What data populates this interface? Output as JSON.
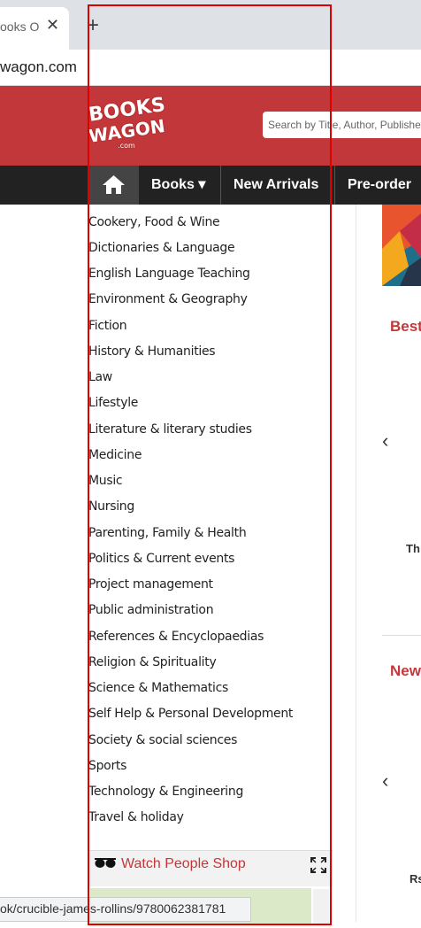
{
  "browser": {
    "tab_title": "ooks On",
    "tab_close": "✕",
    "new_tab": "+",
    "address": "wagon.com",
    "status_url": "ok/crucible-james-rollins/9780062381781"
  },
  "header": {
    "logo_line1": "BOOKS",
    "logo_line2": "WAGON",
    "logo_line3": ".com",
    "search_placeholder": "Search by Title, Author, Publisher",
    "brand_color": "#c2383a"
  },
  "nav": {
    "home_icon": "home-icon",
    "items": [
      {
        "label": "Books ▾"
      },
      {
        "label": "New Arrivals"
      },
      {
        "label": "Pre-order"
      }
    ]
  },
  "categories": [
    "Cookery, Food & Wine",
    "Dictionaries & Language",
    "English Language Teaching",
    "Environment & Geography",
    "Fiction",
    "History & Humanities",
    "Law",
    "Lifestyle",
    "Literature & literary studies",
    "Medicine",
    "Music",
    "Nursing",
    "Parenting, Family & Health",
    "Politics & Current events",
    "Project management",
    "Public administration",
    "References & Encyclopaedias",
    "Religion & Spirituality",
    "Science & Mathematics",
    "Self Help & Personal Development",
    "Society & social sciences",
    "Sports",
    "Technology & Engineering",
    "Travel & holiday"
  ],
  "right": {
    "section1_title": "Best",
    "section1_item": "Th",
    "section2_title": "New",
    "section2_item": "Rs",
    "chevron": "‹"
  },
  "watch": {
    "label": "Watch People Shop",
    "glasses_icon": "glasses-icon",
    "expand_icon": "expand-icon"
  }
}
